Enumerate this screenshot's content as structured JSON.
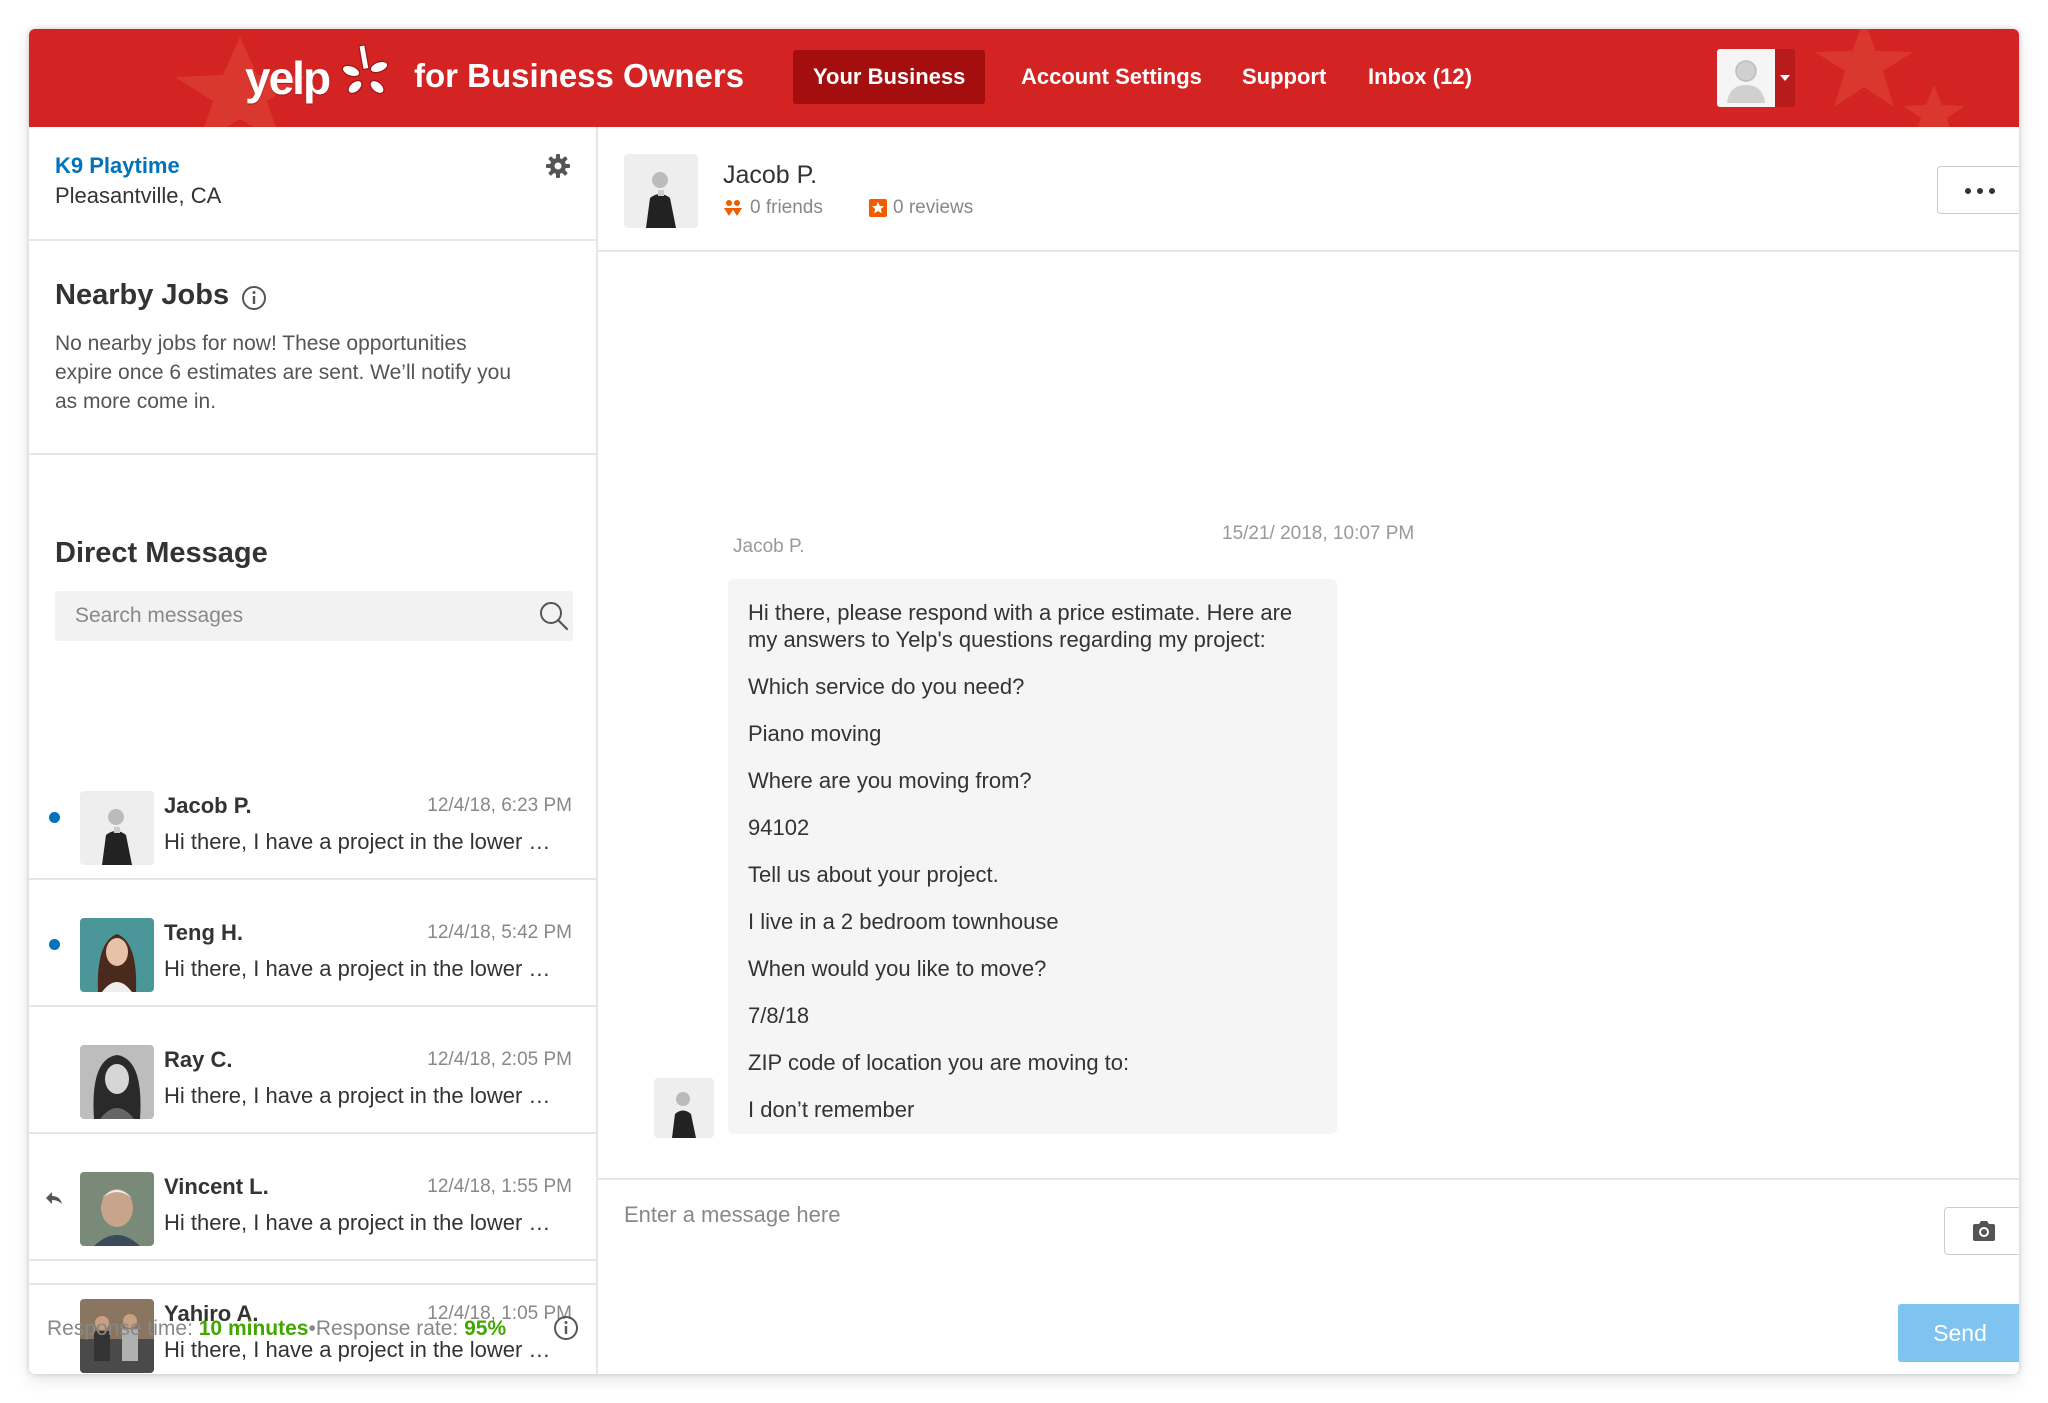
{
  "header": {
    "logo_text": "yelp",
    "title": "for Business Owners",
    "nav": [
      {
        "label": "Your Business",
        "active": true
      },
      {
        "label": "Account Settings",
        "active": false
      },
      {
        "label": "Support",
        "active": false
      },
      {
        "label": "Inbox (12)",
        "active": false
      }
    ],
    "brand_color": "#d32323"
  },
  "business": {
    "name": "K9 Playtime",
    "location": "Pleasantville, CA"
  },
  "nearby_jobs": {
    "title": "Nearby Jobs",
    "text": "No nearby jobs for now! These opportunities expire once 6 estimates are sent. We’ll notify you as more come in."
  },
  "direct_message": {
    "title": "Direct Message",
    "search_placeholder": "Search messages",
    "messages": [
      {
        "name": "Jacob P.",
        "time": "12/4/18, 6:23 PM",
        "preview": "Hi there, I have a project in the lower Pacific Heights",
        "status": "unread"
      },
      {
        "name": "Teng H.",
        "time": "12/4/18, 5:42 PM",
        "preview": "Hi there, I have a project in the lower Pacific Heights",
        "status": "unread"
      },
      {
        "name": "Ray C.",
        "time": "12/4/18, 2:05 PM",
        "preview": "Hi there, I have a project in the lower Pacific Heights",
        "status": "read"
      },
      {
        "name": "Vincent L.",
        "time": "12/4/18, 1:55 PM",
        "preview": "Hi there, I have a project in the lower Pacific Heights",
        "status": "replied"
      },
      {
        "name": "Yahiro A.",
        "time": "12/4/18, 1:05 PM",
        "preview": "Hi there, I have a project in the lower Pacific Heights",
        "status": "read"
      }
    ]
  },
  "stats": {
    "response_time_label": "Response time:",
    "response_time_value": "10 minutes",
    "separator": "•",
    "response_rate_label": "Response rate:",
    "response_rate_value": "95%"
  },
  "conversation": {
    "name": "Jacob P.",
    "friends": "0 friends",
    "reviews": "0 reviews",
    "sender_label": "Jacob P.",
    "timestamp": "15/21/ 2018, 10:07 PM",
    "lines": [
      "Hi there, please respond with a price estimate. Here are my answers to Yelp's questions regarding my project:",
      "Which service do you need?",
      "Piano moving",
      "Where are you moving from?",
      "94102",
      "Tell us about your project.",
      "I live in a 2 bedroom townhouse",
      "When would you like to move?",
      "7/8/18",
      "ZIP code of location you are moving to:",
      "I don’t remember"
    ]
  },
  "compose": {
    "placeholder": "Enter a message here",
    "send_label": "Send"
  }
}
